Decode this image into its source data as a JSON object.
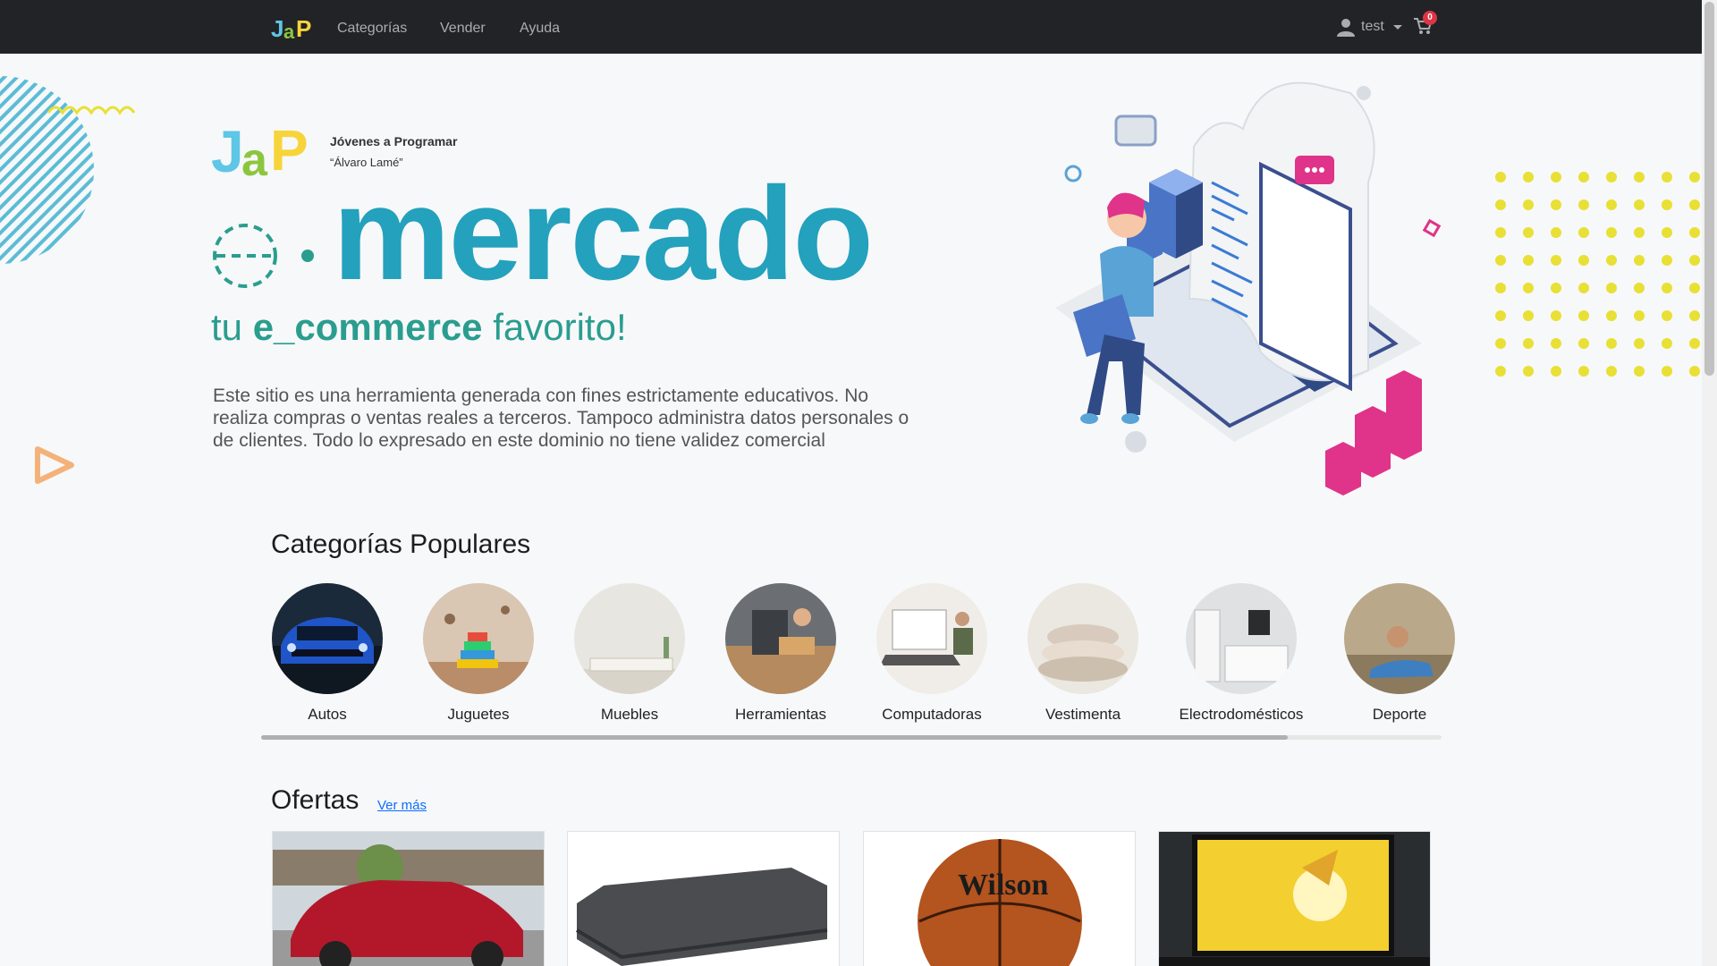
{
  "navbar": {
    "links": [
      "Categorías",
      "Vender",
      "Ayuda"
    ],
    "user": "test",
    "cart_count": "0"
  },
  "hero": {
    "org_name": "Jóvenes a Programar",
    "org_sub": "“Álvaro Lamé”",
    "brand": "mercado",
    "tagline_pre": "tu ",
    "tagline_bold": "e_commerce",
    "tagline_post": " favorito!",
    "disclaimer": "Este sitio  es una herramienta generada con fines estrictamente educativos. No realiza compras o ventas reales a terceros. Tampoco administra datos personales o de clientes. Todo lo expresado en este dominio no tiene validez comercial"
  },
  "categories": {
    "title": "Categorías Populares",
    "items": [
      "Autos",
      "Juguetes",
      "Muebles",
      "Herramientas",
      "Computadoras",
      "Vestimenta",
      "Electrodomésticos",
      "Deporte"
    ]
  },
  "offers": {
    "title": "Ofertas",
    "more": "Ver más"
  },
  "colors": {
    "navbar": "#222326",
    "brand_blue": "#23a1bd",
    "brand_green": "#2a9d8f",
    "accent_yellow": "#e8e034",
    "accent_pink": "#e0338a"
  }
}
